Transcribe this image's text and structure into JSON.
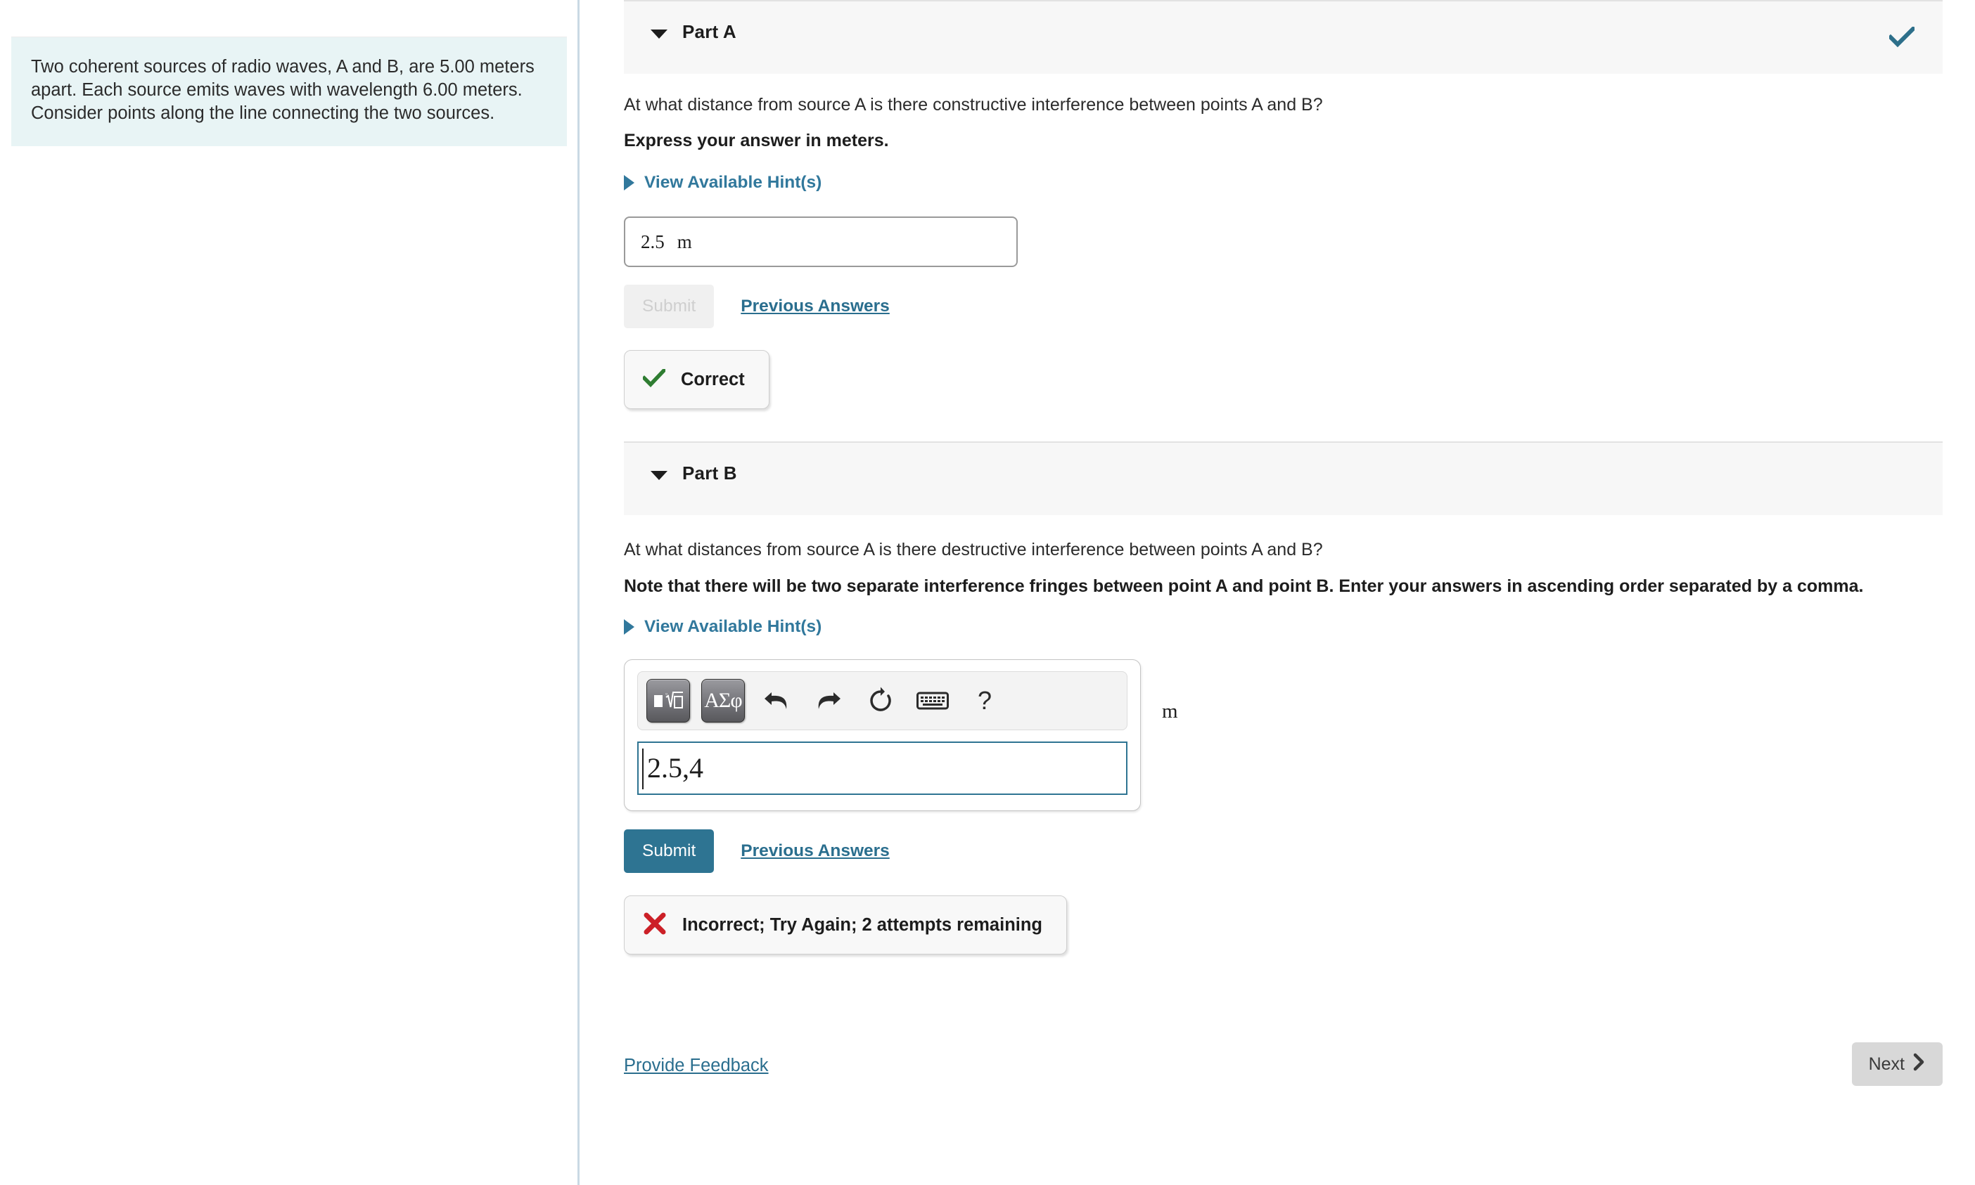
{
  "problem": {
    "statement": "Two coherent sources of radio waves, A and B, are 5.00 meters apart. Each source emits waves with wavelength 6.00 meters. Consider points along the line connecting the two sources."
  },
  "part_a": {
    "title": "Part A",
    "status_icon": "check-icon",
    "status_color": "#2d6f8a",
    "question": "At what distance from source A is there constructive interference between points A and B?",
    "instruction": "Express your answer in meters.",
    "hint_label": "View Available Hint(s)",
    "answer_value": "2.5",
    "answer_unit": "m",
    "submit_label": "Submit",
    "submit_enabled": false,
    "previous_answers_label": "Previous Answers",
    "feedback": {
      "icon": "check-icon",
      "color": "#2f7d32",
      "text": "Correct"
    }
  },
  "part_b": {
    "title": "Part B",
    "question": "At what distances from source A is there destructive interference between points A and B?",
    "instruction": "Note that there will be two separate interference fringes between point A and point B. Enter your answers in ascending order separated by a comma.",
    "hint_label": "View Available Hint(s)",
    "toolbar": {
      "template_button": "template-icon",
      "greek_button": "ΑΣφ",
      "undo": "undo-icon",
      "redo": "redo-icon",
      "reset": "reset-icon",
      "keyboard": "keyboard-icon",
      "help": "?"
    },
    "answer_value": "2.5,4",
    "answer_unit": "m",
    "submit_label": "Submit",
    "submit_enabled": true,
    "previous_answers_label": "Previous Answers",
    "feedback": {
      "icon": "x-icon",
      "color": "#cc2027",
      "text": "Incorrect; Try Again; 2 attempts remaining"
    }
  },
  "footer": {
    "provide_feedback_label": "Provide Feedback",
    "next_label": "Next"
  },
  "colors": {
    "accent_link": "#31789c",
    "submit_bg": "#2e7492",
    "header_bg": "#f7f7f7",
    "problem_bg": "#e8f4f5",
    "divider": "#c9d9e4"
  }
}
